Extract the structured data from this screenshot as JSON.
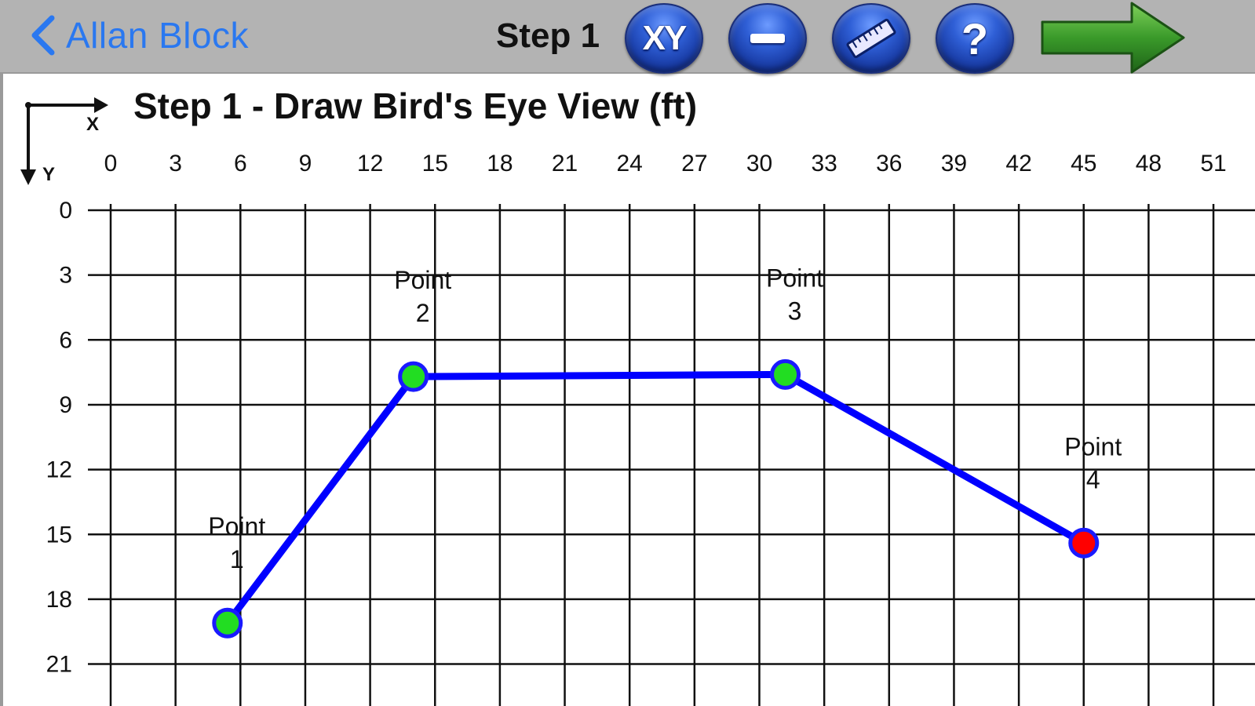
{
  "nav": {
    "back_label": "Allan Block",
    "step_title": "Step 1"
  },
  "toolbar": {
    "xy_label": "XY",
    "help_label": "?",
    "buttons": [
      {
        "name": "xy-button",
        "icon": "xy-icon"
      },
      {
        "name": "minus-button",
        "icon": "minus-icon"
      },
      {
        "name": "ruler-button",
        "icon": "ruler-icon"
      },
      {
        "name": "help-button",
        "icon": "help-icon"
      },
      {
        "name": "next-button",
        "icon": "arrow-right-icon"
      }
    ]
  },
  "canvas": {
    "title": "Step 1 - Draw Bird's Eye View (ft)",
    "axis_x_label": "X",
    "axis_y_label": "Y"
  },
  "chart_data": {
    "type": "line",
    "x_ticks": [
      0,
      3,
      6,
      9,
      12,
      15,
      18,
      21,
      24,
      27,
      30,
      33,
      36,
      39,
      42,
      45,
      48,
      51
    ],
    "y_ticks": [
      0,
      3,
      6,
      9,
      12,
      15,
      18,
      21
    ],
    "y_inverted": true,
    "grid": true,
    "points": [
      {
        "label_line1": "Point",
        "label_line2": "1",
        "x": 5.4,
        "y": 19.1,
        "status": "complete"
      },
      {
        "label_line1": "Point",
        "label_line2": "2",
        "x": 14.0,
        "y": 7.7,
        "status": "complete"
      },
      {
        "label_line1": "Point",
        "label_line2": "3",
        "x": 31.2,
        "y": 7.6,
        "status": "complete"
      },
      {
        "label_line1": "Point",
        "label_line2": "4",
        "x": 45.0,
        "y": 15.4,
        "status": "current"
      }
    ]
  },
  "colors": {
    "nav_bar": "#b3b3b3",
    "back_link": "#2a78f0",
    "wall_line": "#0000ff",
    "point_complete": "#22dd22",
    "point_current": "#ff0000",
    "point_outline": "#1a1aff",
    "grid_line": "#111111",
    "next_arrow": "#3a9a2a"
  }
}
